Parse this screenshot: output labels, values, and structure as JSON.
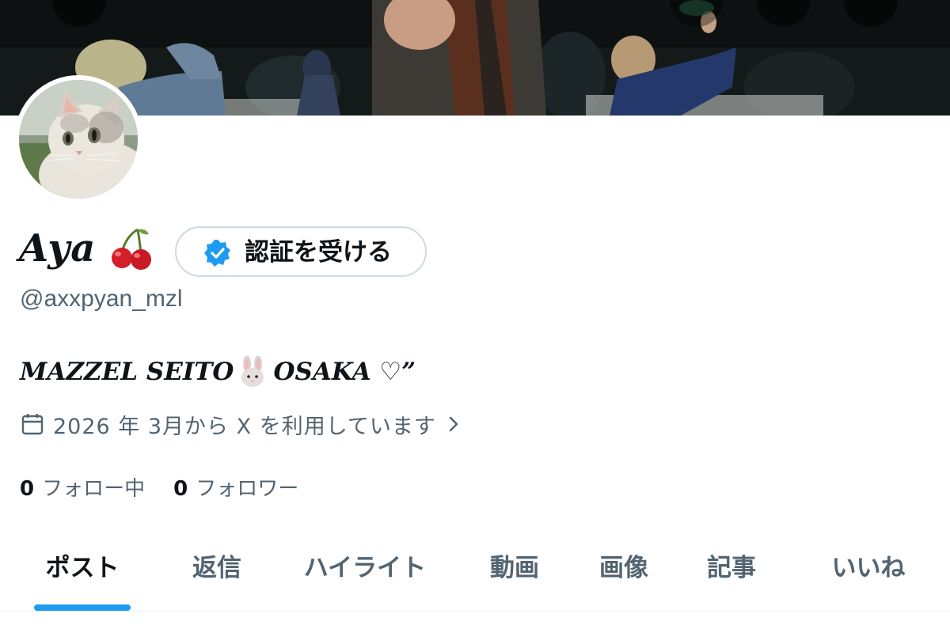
{
  "profile": {
    "display_name": "Aya",
    "name_emoji_icon": "cherry-icon",
    "handle": "@axxpyan_mzl",
    "verify_button_label": "認証を受ける",
    "verify_icon": "verified-badge-icon",
    "bio_part1": "MAZZEL SEITO",
    "bio_emoji_icon": "rabbit-face-icon",
    "bio_part2": "OSAKA ♡”",
    "joined_text": "2026 年 3月から X を利用しています",
    "joined_icon": "calendar-icon",
    "following_count": "0",
    "following_label": "フォロー中",
    "followers_count": "0",
    "followers_label": "フォロワー"
  },
  "tabs": [
    {
      "label": "ポスト",
      "active": true
    },
    {
      "label": "返信",
      "active": false
    },
    {
      "label": "ハイライト",
      "active": false
    },
    {
      "label": "動画",
      "active": false
    },
    {
      "label": "画像",
      "active": false
    },
    {
      "label": "記事",
      "active": false
    },
    {
      "label": "いいね",
      "active": false
    }
  ],
  "colors": {
    "accent": "#1d9bf0",
    "text_primary": "#0f1419",
    "text_secondary": "#536471",
    "border": "#cfd9de"
  }
}
